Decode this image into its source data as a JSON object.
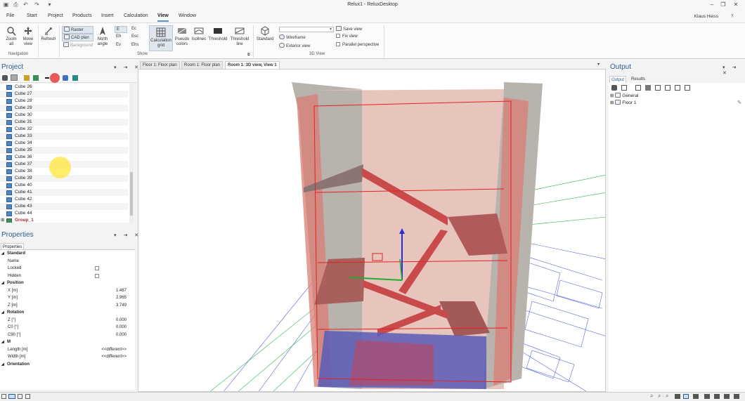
{
  "window": {
    "title": "Relux1 - ReluxDesktop"
  },
  "menu": [
    "File",
    "Start",
    "Project",
    "Products",
    "Insert",
    "Calculation",
    "View",
    "Window"
  ],
  "menu_active": "View",
  "user": "Klaus Heiss",
  "ribbon": {
    "navigation": {
      "zoom_all": "Zoom all",
      "move_view": "Move view",
      "group": "Navigation"
    },
    "refresh": "Refresh",
    "raster": "Raster",
    "cad_plan": "CAD plan",
    "background": "Background",
    "north_angle": "North angle",
    "e": "E",
    "eh": "Eh",
    "ev": "Ev",
    "ec": "Ec",
    "esc": "Esc",
    "ehs": "Ehs",
    "calculation_grid": "Calculation grid",
    "pseudo_colors": "Pseudo colors",
    "isolines": "Isolines",
    "threshold": "Threshold",
    "threshold_line": "Threshold line",
    "show_group": "Show",
    "standard": "Standard",
    "wireframe": "Wireframe",
    "exterior_view": "Exterior view",
    "save_view": "Save view",
    "fix_view": "Fix view",
    "parallel_perspective": "Parallel perspective",
    "view3d_group": "3D View"
  },
  "project": {
    "title": "Project",
    "items": [
      "Cube 26",
      "Cube 27",
      "Cube 28",
      "Cube 29",
      "Cube 30",
      "Cube 31",
      "Cube 32",
      "Cube 33",
      "Cube 34",
      "Cube 35",
      "Cube 36",
      "Cube 37",
      "Cube 38",
      "Cube 39",
      "Cube 40",
      "Cube 41",
      "Cube 42",
      "Cube 43",
      "Cube 44"
    ],
    "group": "Group_1"
  },
  "properties": {
    "title": "Properties",
    "tab": "Properties",
    "rows": [
      {
        "name": "Standard",
        "value": "",
        "section": true
      },
      {
        "name": "Name",
        "value": ""
      },
      {
        "name": "Locked",
        "value": "",
        "check": true
      },
      {
        "name": "Hidden",
        "value": "",
        "check": true
      },
      {
        "name": "Position",
        "value": "",
        "section": true
      },
      {
        "name": "X [m]",
        "value": "1.467"
      },
      {
        "name": "Y [m]",
        "value": "2.965"
      },
      {
        "name": "Z [m]",
        "value": "3.749"
      },
      {
        "name": "Rotation",
        "value": "",
        "section": true
      },
      {
        "name": "Z [°]",
        "value": "0.000"
      },
      {
        "name": "C0 [°]",
        "value": "0.000"
      },
      {
        "name": "C90 [°]",
        "value": "0.000"
      },
      {
        "name": "M",
        "value": "",
        "section": true
      },
      {
        "name": "Length [m]",
        "value": "<<different>>"
      },
      {
        "name": "Width [m]",
        "value": "<<different>>"
      },
      {
        "name": "Orientation",
        "value": "",
        "section": true
      }
    ]
  },
  "doc_tabs": [
    "Floor 1: Floor plan",
    "Room 1: Floor plan",
    "Room 1: 3D view, View 1"
  ],
  "output": {
    "title": "Output",
    "tabs": [
      "Output",
      "Results"
    ],
    "tree": [
      "General",
      "Floor 1"
    ]
  },
  "colors": {
    "accent": "#2a5d8f",
    "tab_underline": "#5b8fc7",
    "room_red": "#e06b6b",
    "cube_blue": "#4f86c6"
  }
}
